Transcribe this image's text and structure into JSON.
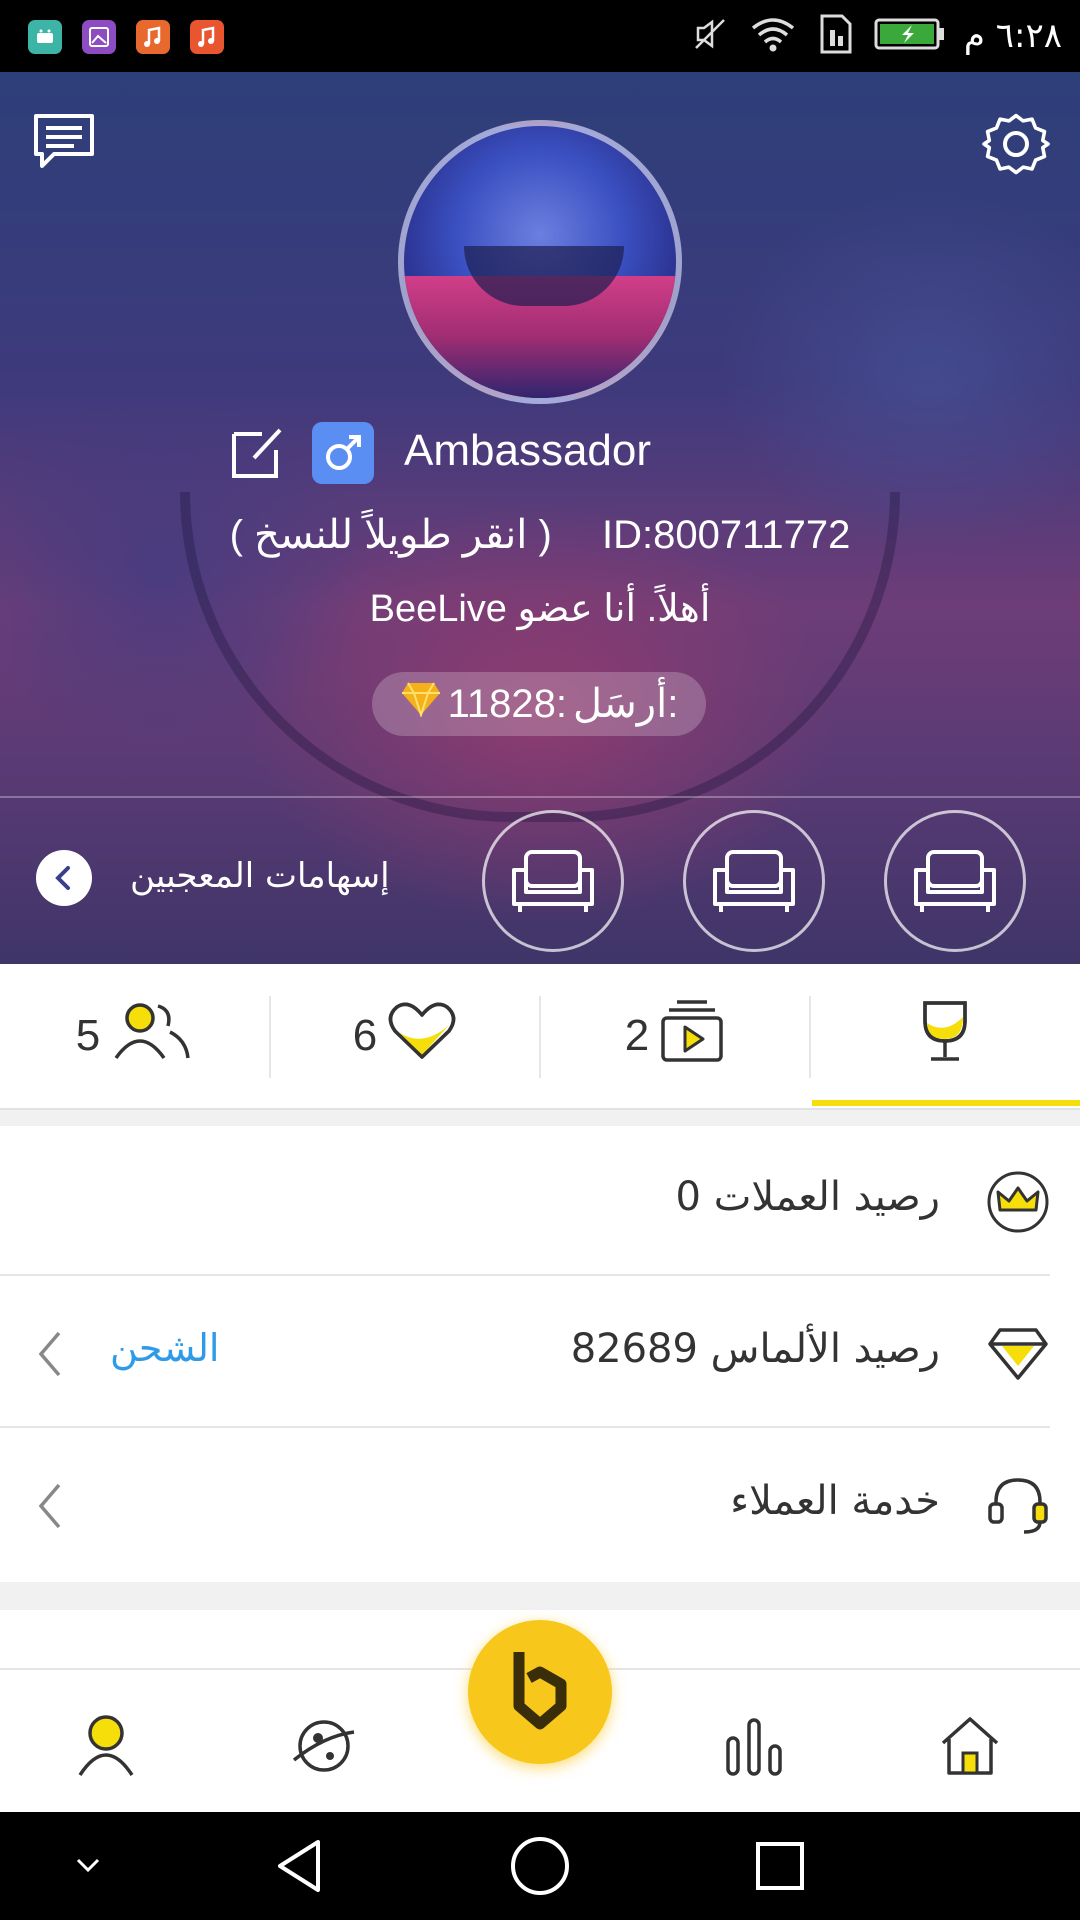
{
  "status_bar": {
    "time": "٦:٢٨ م",
    "app_icons": [
      "android-icon",
      "gallery-icon",
      "music-icon",
      "music-icon"
    ],
    "app_colors": [
      "#3db5a6",
      "#8e4cc2",
      "#e8692e",
      "#e8552e"
    ]
  },
  "profile": {
    "name": "Ambassador",
    "id_text": "ID:800711772",
    "copy_hint": "( انقر طويلاً للنسخ )",
    "bio": "أهلاً. أنا عضو BeeLive",
    "sent_label": "أرسَل:",
    "sent_value": "11828:"
  },
  "fans": {
    "label": "إسهامات المعجبين"
  },
  "stats": {
    "followers": "5",
    "likes": "6",
    "videos": "2"
  },
  "list": {
    "coins_label": "رصيد العملات",
    "coins_value": "0",
    "diamonds_label": "رصيد الألماس",
    "diamonds_value": "82689",
    "recharge": "الشحن",
    "support_label": "خدمة العملاء"
  },
  "colors": {
    "accent_yellow": "#f5de0a",
    "link_blue": "#2f9be8",
    "brand_yellow": "#f8c71b"
  }
}
